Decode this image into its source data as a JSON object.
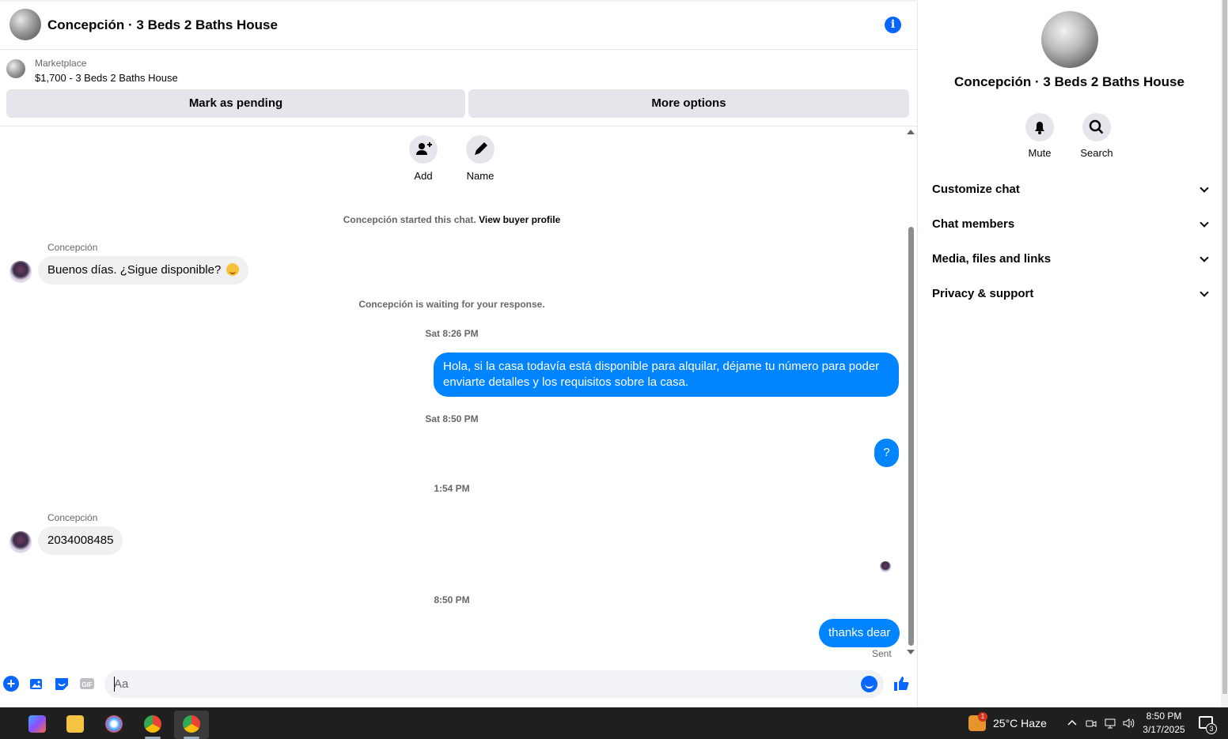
{
  "header": {
    "title": "Concepción · 3 Beds 2 Baths House",
    "info_icon": "info-icon"
  },
  "marketplace": {
    "label": "Marketplace",
    "listing": "$1,700 - 3 Beds 2 Baths House",
    "mark_pending": "Mark as pending",
    "more_options": "More options"
  },
  "actions": {
    "add": "Add",
    "name": "Name"
  },
  "feed": {
    "started_prefix": "Concepción started this chat.",
    "view_profile": "View buyer profile",
    "waiting": "Concepción is waiting for your response.",
    "time1": "Sat 8:26 PM",
    "time2": "Sat 8:50 PM",
    "time3": "1:54 PM",
    "time4": "8:50 PM",
    "sender": "Concepción",
    "msg1": "Buenos días. ¿Sigue disponible?",
    "msg2": "Hola, si la casa todavía está disponible para alquilar, déjame tu número para poder enviarte detalles y los requisitos sobre la casa.",
    "msg3": "?",
    "msg4": "2034008485",
    "msg5": "thanks dear",
    "sent": "Sent"
  },
  "composer": {
    "placeholder": "Aa",
    "gif": "GIF"
  },
  "panel": {
    "title": "Concepción · 3 Beds 2 Baths House",
    "mute": "Mute",
    "search": "Search",
    "rows": [
      "Customize chat",
      "Chat members",
      "Media, files and links",
      "Privacy & support"
    ]
  },
  "taskbar": {
    "weather": "25°C  Haze",
    "weather_badge": "1",
    "time": "8:50 PM",
    "date": "3/17/2025",
    "notif_count": "3"
  },
  "colors": {
    "accent": "#0866ff",
    "bubble_out": "#0084ff",
    "bubble_in": "#f0f0f0",
    "button_bg": "#e4e6eb"
  }
}
